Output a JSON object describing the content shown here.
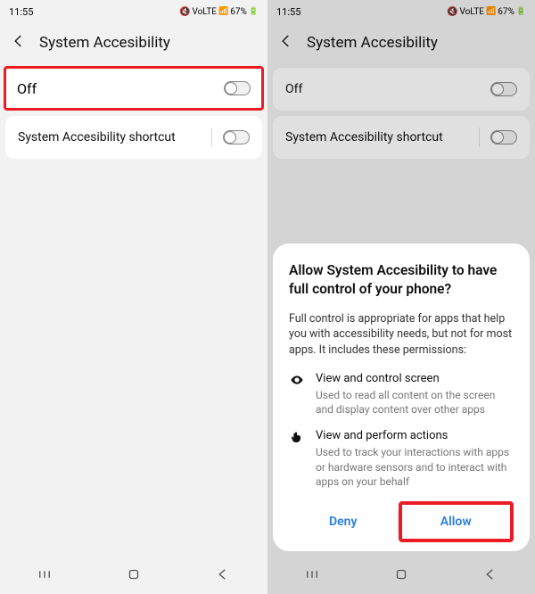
{
  "status": {
    "time": "11:55",
    "network": "VoLTE",
    "battery": "67%"
  },
  "header": {
    "title": "System Accesibility"
  },
  "rows": {
    "off_label": "Off",
    "shortcut_label": "System Accesibility shortcut"
  },
  "dialog": {
    "title": "Allow System Accesibility to have full control of your phone?",
    "body": "Full control is appropriate for apps that help you with accessibility needs, but not for most apps. It includes these permissions:",
    "perm1_title": "View and control screen",
    "perm1_desc": "Used to read all content on the screen and display content over other apps",
    "perm2_title": "View and perform actions",
    "perm2_desc": "Used to track your interactions with apps or hardware sensors and to interact with apps on your behalf",
    "deny": "Deny",
    "allow": "Allow"
  }
}
